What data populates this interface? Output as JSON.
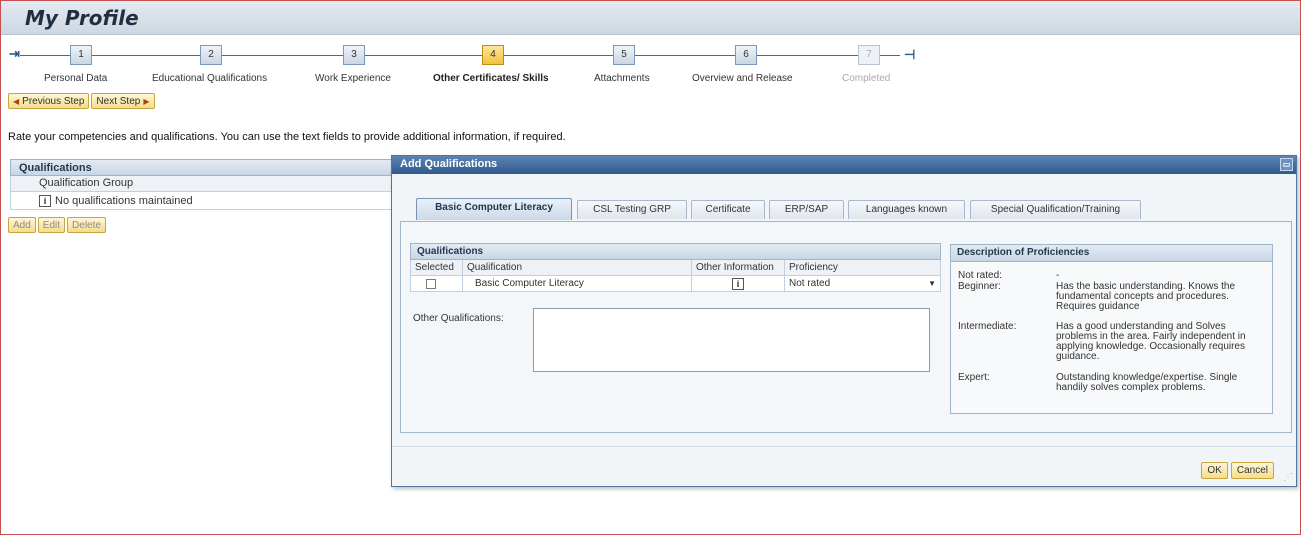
{
  "page": {
    "title": "My Profile"
  },
  "roadmap": {
    "steps": [
      {
        "num": "1",
        "label": "Personal Data",
        "state": "normal"
      },
      {
        "num": "2",
        "label": "Educational Qualifications",
        "state": "normal"
      },
      {
        "num": "3",
        "label": "Work Experience",
        "state": "normal"
      },
      {
        "num": "4",
        "label": "Other Certificates/ Skills",
        "state": "active"
      },
      {
        "num": "5",
        "label": "Attachments",
        "state": "normal"
      },
      {
        "num": "6",
        "label": "Overview and Release",
        "state": "normal"
      },
      {
        "num": "7",
        "label": "Completed",
        "state": "disabled"
      }
    ],
    "prev_label": "Previous Step",
    "next_label": "Next Step"
  },
  "instructions": "Rate your competencies and qualifications. You can use the text fields to provide additional information, if required.",
  "background_table": {
    "title": "Qualifications",
    "column": "Qualification Group",
    "empty_text": "No qualifications maintained",
    "buttons": {
      "add": "Add",
      "edit": "Edit",
      "delete": "Delete"
    }
  },
  "dialog": {
    "title": "Add Qualifications",
    "tabs": [
      "Basic Computer Literacy",
      "CSL Testing GRP",
      "Certificate",
      "ERP/SAP",
      "Languages known",
      "Special Qualification/Training"
    ],
    "qualifications": {
      "title": "Qualifications",
      "columns": {
        "selected": "Selected",
        "qualification": "Qualification",
        "other": "Other Information",
        "proficiency": "Proficiency"
      },
      "rows": [
        {
          "qualification": "Basic Computer Literacy",
          "proficiency": "Not rated"
        }
      ]
    },
    "other_qualifications_label": "Other Qualifications:",
    "other_qualifications_value": "",
    "description": {
      "title": "Description of Proficiencies",
      "entries": [
        {
          "term": "Not rated:",
          "def": "-"
        },
        {
          "term": "Beginner:",
          "def": "Has the basic understanding. Knows the fundamental concepts and procedures. Requires guidance"
        },
        {
          "term": "Intermediate:",
          "def": "Has a good understanding and Solves problems in the area. Fairly independent in applying knowledge. Occasionally requires guidance."
        },
        {
          "term": "Expert:",
          "def": "Outstanding knowledge/expertise. Single handily solves complex problems."
        }
      ]
    },
    "buttons": {
      "ok": "OK",
      "cancel": "Cancel"
    }
  },
  "colors": {
    "active_step": "#f3c23c",
    "dialog_title": "#2f5a8c",
    "frame": "#c4504e"
  }
}
